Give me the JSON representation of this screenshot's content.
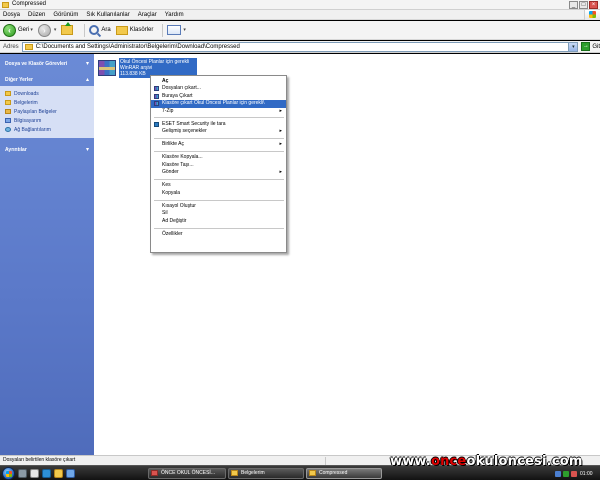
{
  "window": {
    "title": "Compressed"
  },
  "menubar": {
    "items": [
      "Dosya",
      "Düzen",
      "Görünüm",
      "Sık Kullanılanlar",
      "Araçlar",
      "Yardım"
    ]
  },
  "toolbar": {
    "back_label": "Geri",
    "search_label": "Ara",
    "folders_label": "Klasörler"
  },
  "address": {
    "label": "Adres",
    "path": "C:\\Documents and Settings\\Administrator\\Belgelerim\\Download\\Compressed",
    "go_label": "Git"
  },
  "sidebar": {
    "file_tasks_header": "Dosya ve Klasör Görevleri",
    "other_places_header": "Diğer Yerler",
    "other_places": [
      "Downloads",
      "Belgelerim",
      "Paylaşılan Belgeler",
      "Bilgisayarım",
      "Ağ Bağlantılarım"
    ],
    "details_header": "Ayrıntılar"
  },
  "file": {
    "name": "Okul Öncesi Planlar için gerekli",
    "type": "WinRAR arşivi",
    "size": "113.838 KB"
  },
  "context_menu": {
    "open": "Aç",
    "extract_files": "Dosyaları çıkart...",
    "extract_here": "Buraya Çıkart",
    "extract_to": "Klasöre çıkart Okul Öncesi Planlar için gerekli\\",
    "seven_zip": "7-Zip",
    "eset_scan": "ESET Smart Security ile tara",
    "advanced_options": "Gelişmiş seçenekler",
    "open_with": "Birlikte Aç",
    "copy_to_folder": "Klasöre Kopyala...",
    "move_to_folder": "Klasöre Taşı...",
    "send_to": "Gönder",
    "cut": "Kes",
    "copy": "Kopyala",
    "create_shortcut": "Kısayol Oluştur",
    "delete": "Sil",
    "rename": "Ad Değiştir",
    "properties": "Özellikler"
  },
  "statusbar": {
    "text": "Dosyaları belirtilen klasöre çıkart"
  },
  "taskbar": {
    "tasks": [
      "ÖNCE OKUL ÖNCESİ...",
      "Belgelerim",
      "Compressed"
    ],
    "clock": "01:00"
  },
  "watermark": {
    "prefix": "www.",
    "highlight": "once",
    "suffix": "okuloncesi.com"
  }
}
